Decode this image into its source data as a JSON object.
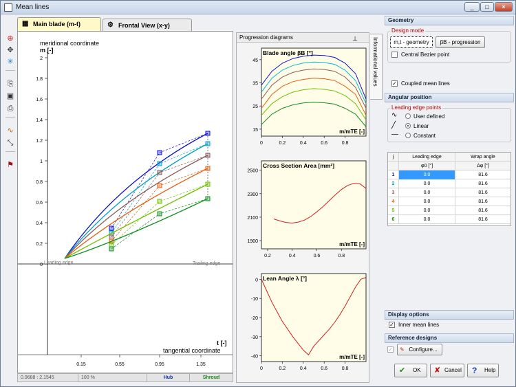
{
  "window": {
    "title": "Mean lines",
    "min": "_",
    "max": "□",
    "close": "×"
  },
  "tabs": [
    {
      "label": "Main blade (m-t)"
    },
    {
      "label": "Frontal View (x-y)"
    }
  ],
  "main_plot": {
    "ylabel_top": "meridional coordinate",
    "ylabel_unit": "m [-]",
    "xlabel_unit": "t [-]",
    "xlabel": "tangential coordinate",
    "leading_edge": "Leading edge",
    "trailing_edge": "Trailing edge",
    "y_ticks": [
      "2",
      "1.8",
      "1.6",
      "1.4",
      "1.2",
      "1",
      "0.8",
      "0.6",
      "0.4",
      "0.2",
      "0"
    ],
    "x_ticks": [
      "0.15",
      "0.55",
      "0.95",
      "1.35"
    ]
  },
  "status": {
    "coords": "0.9688 : 2.1545",
    "zoom": "100 %",
    "hub": "Hub",
    "shroud": "Shroud"
  },
  "progression": {
    "header": "Progression diagrams",
    "side_tab": "Informational values"
  },
  "chart_data": [
    {
      "type": "line",
      "title": "Blade angle βB [°]",
      "xlabel": "m/mTE [-]",
      "ylabel": "",
      "x_ticks": [
        "0",
        "0.2",
        "0.4",
        "0.6",
        "0.8"
      ],
      "y_ticks": [
        "15",
        "25",
        "35",
        "45"
      ],
      "xlim": [
        0,
        1
      ],
      "ylim": [
        12,
        50
      ],
      "x": [
        0,
        0.1,
        0.2,
        0.3,
        0.4,
        0.5,
        0.6,
        0.7,
        0.8,
        0.9,
        1.0
      ],
      "series": [
        {
          "color": "#1010d0",
          "values": [
            34,
            40,
            43.5,
            45.5,
            46.5,
            47,
            46.8,
            46,
            43.5,
            39,
            28
          ]
        },
        {
          "color": "#00b8d8",
          "values": [
            31,
            37,
            40.5,
            42.5,
            43.6,
            44,
            43.8,
            43,
            40.5,
            36,
            26
          ]
        },
        {
          "color": "#8a5a5a",
          "values": [
            28,
            34,
            37.5,
            39.5,
            40.5,
            41,
            40.8,
            40,
            37.5,
            33,
            24
          ]
        },
        {
          "color": "#e06010",
          "values": [
            24,
            30,
            33.5,
            35.5,
            36.5,
            37,
            36.8,
            36,
            33.5,
            30,
            21
          ]
        },
        {
          "color": "#70c000",
          "values": [
            21,
            26,
            29,
            31,
            32,
            32.5,
            32.2,
            31.5,
            29.5,
            26,
            19
          ]
        },
        {
          "color": "#109020",
          "values": [
            17,
            21.5,
            24,
            25.5,
            26.3,
            26.6,
            26.4,
            25.8,
            24,
            21.5,
            16
          ]
        }
      ]
    },
    {
      "type": "line",
      "title": "Cross Section Area [mm²]",
      "xlabel": "m/mTE [-]",
      "ylabel": "",
      "x_ticks": [
        "0.2",
        "0.4",
        "0.6",
        "0.8"
      ],
      "y_ticks": [
        "1900",
        "2100",
        "2300",
        "2500"
      ],
      "xlim": [
        0.15,
        1
      ],
      "ylim": [
        1830,
        2580
      ],
      "series": [
        {
          "color": "#d02020",
          "x": [
            0.25,
            0.3,
            0.35,
            0.4,
            0.45,
            0.5,
            0.55,
            0.6,
            0.65,
            0.7,
            0.75,
            0.8,
            0.85,
            0.9,
            0.95,
            1.0
          ],
          "values": [
            2085,
            2068,
            2055,
            2050,
            2058,
            2075,
            2105,
            2145,
            2190,
            2240,
            2290,
            2335,
            2370,
            2388,
            2385,
            2345
          ]
        }
      ]
    },
    {
      "type": "line",
      "title": "Lean Angle λ [°]",
      "xlabel": "m/mTE [-]",
      "ylabel": "",
      "x_ticks": [
        "0",
        "0.2",
        "0.4",
        "0.6",
        "0.8"
      ],
      "y_ticks": [
        "0",
        "-10",
        "-20",
        "-30",
        "-40"
      ],
      "xlim": [
        0,
        1
      ],
      "ylim": [
        -43,
        3
      ],
      "series": [
        {
          "color": "#d02020",
          "x": [
            0,
            0.05,
            0.1,
            0.15,
            0.2,
            0.25,
            0.3,
            0.35,
            0.4,
            0.45,
            0.5,
            0.55,
            0.6,
            0.65,
            0.7,
            0.75,
            0.8,
            0.85,
            0.9,
            0.95,
            1.0
          ],
          "values": [
            0,
            -6,
            -12,
            -17,
            -22,
            -26,
            -30,
            -33.5,
            -37,
            -39.5,
            -35,
            -32,
            -29,
            -26,
            -22.5,
            -18.5,
            -14,
            -9,
            -4,
            0,
            1
          ]
        }
      ]
    }
  ],
  "geometry": {
    "header": "Geometry",
    "design_mode": "Design mode",
    "btn_mt": "m,t - geometry",
    "btn_beta": "βB - progression",
    "central_bezier": "Central Bezier point",
    "coupled": "Coupled mean lines"
  },
  "angular": {
    "header": "Angular position",
    "le_points": "Leading edge points",
    "opt_user": "User defined",
    "opt_linear": "Linear",
    "opt_constant": "Constant"
  },
  "table": {
    "col_j": "j",
    "col_le": "Leading edge",
    "col_wrap": "Wrap angle",
    "sub_le": "φ0 [°]",
    "sub_wrap": "Δφ [°]",
    "rows": [
      {
        "j": "1",
        "le": "0.0",
        "wrap": "81.6",
        "color": "#1010d0"
      },
      {
        "j": "2",
        "le": "0.0",
        "wrap": "81.6",
        "color": "#00a0c0"
      },
      {
        "j": "3",
        "le": "0.0",
        "wrap": "81.6",
        "color": "#8a5a5a"
      },
      {
        "j": "4",
        "le": "0.0",
        "wrap": "81.6",
        "color": "#e06010"
      },
      {
        "j": "5",
        "le": "0.0",
        "wrap": "81.6",
        "color": "#70c000"
      },
      {
        "j": "6",
        "le": "0.0",
        "wrap": "81.6",
        "color": "#109020"
      }
    ]
  },
  "display": {
    "header": "Display options",
    "inner": "Inner mean lines"
  },
  "reference": {
    "header": "Reference designs",
    "configure": "Configure..."
  },
  "footer": {
    "ok": "OK",
    "cancel": "Cancel",
    "help": "Help"
  }
}
